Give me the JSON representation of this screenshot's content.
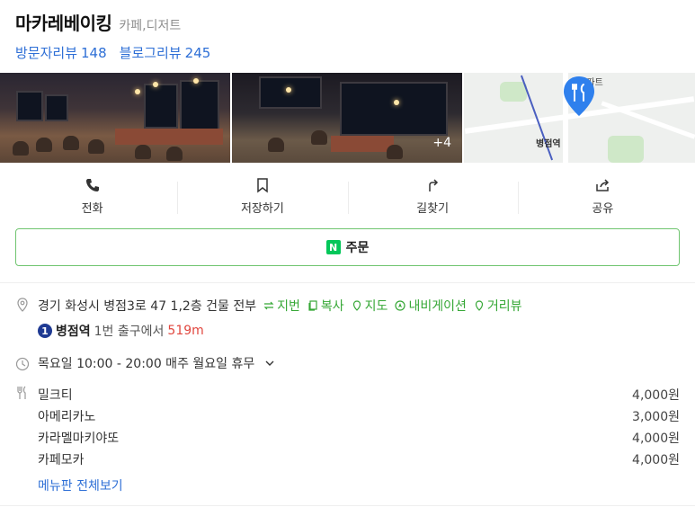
{
  "place": {
    "name": "마카레베이킹",
    "category": "카페,디저트",
    "reviews": [
      {
        "label": "방문자리뷰",
        "count": "148"
      },
      {
        "label": "블로그리뷰",
        "count": "245"
      }
    ]
  },
  "photos": {
    "more_badge": "+4",
    "map": {
      "label_apt": "이아파트",
      "label_station": "병점역"
    }
  },
  "actions": [
    {
      "label": "전화",
      "icon": "phone-icon"
    },
    {
      "label": "저장하기",
      "icon": "bookmark-icon"
    },
    {
      "label": "길찾기",
      "icon": "directions-icon"
    },
    {
      "label": "공유",
      "icon": "share-icon"
    }
  ],
  "order": {
    "badge": "N",
    "label": "주문"
  },
  "address": {
    "text": "경기 화성시 병점3로 47 1,2층 건물 전부",
    "links": [
      "지번",
      "복사",
      "지도",
      "내비게이션",
      "거리뷰"
    ]
  },
  "subway": {
    "line": "1",
    "station": "병점역",
    "exit": "1번 출구에서",
    "distance": "519m"
  },
  "hours": {
    "text": "목요일 10:00 - 20:00 매주 월요일 휴무"
  },
  "menu": {
    "items": [
      {
        "name": "밀크티",
        "price": "4,000원"
      },
      {
        "name": "아메리카노",
        "price": "3,000원"
      },
      {
        "name": "카라멜마키야또",
        "price": "4,000원"
      },
      {
        "name": "카페모카",
        "price": "4,000원"
      }
    ],
    "view_all": "메뉴판 전체보기"
  },
  "colors": {
    "accent_blue": "#2e6fd6",
    "naver_green": "#03c75a",
    "link_green": "#35a735",
    "distance_red": "#e1473f",
    "line1_blue": "#1f3a93"
  }
}
